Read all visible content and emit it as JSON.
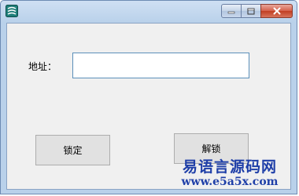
{
  "window": {
    "caption_buttons": {
      "minimize_icon": "minimize-icon",
      "maximize_icon": "maximize-icon",
      "close_icon": "close-icon"
    }
  },
  "form": {
    "address_label": "地址：",
    "address_value": "",
    "lock_label": "锁定",
    "unlock_label": "解锁"
  },
  "watermark": {
    "line1": "易语言源码网",
    "line2": "www.e5a5x.com"
  },
  "colors": {
    "title_bar": "#b9d1ea",
    "client_bg": "#f0f0f0",
    "close_button": "#c13e22",
    "watermark": "#1f3fa8"
  }
}
